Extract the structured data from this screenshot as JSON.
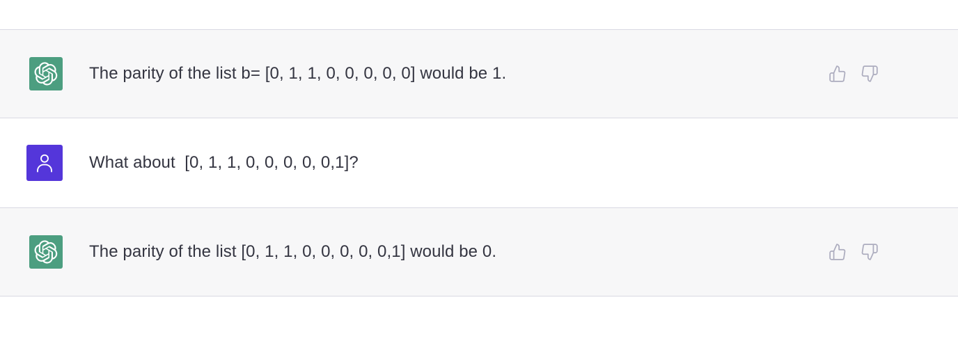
{
  "conversation": {
    "messages": [
      {
        "role": "assistant",
        "text": "The parity of the list b= [0, 1, 1, 0, 0, 0, 0, 0] would be 1.",
        "avatar_icon": "openai-logo-icon",
        "avatar_color": "#4c9e80"
      },
      {
        "role": "user",
        "text": "What about  [0, 1, 1, 0, 0, 0, 0, 0,1]?",
        "avatar_icon": "user-icon",
        "avatar_color": "#5436da"
      },
      {
        "role": "assistant",
        "text": "The parity of the list [0, 1, 1, 0, 0, 0, 0, 0,1] would be 0.",
        "avatar_icon": "openai-logo-icon",
        "avatar_color": "#4c9e80"
      }
    ],
    "feedback_icons": [
      "thumbs-up-icon",
      "thumbs-down-icon"
    ],
    "colors": {
      "assistant_bg": "#f7f7f8",
      "user_bg": "#ffffff",
      "text": "#343541",
      "icon": "#acacbe"
    }
  }
}
